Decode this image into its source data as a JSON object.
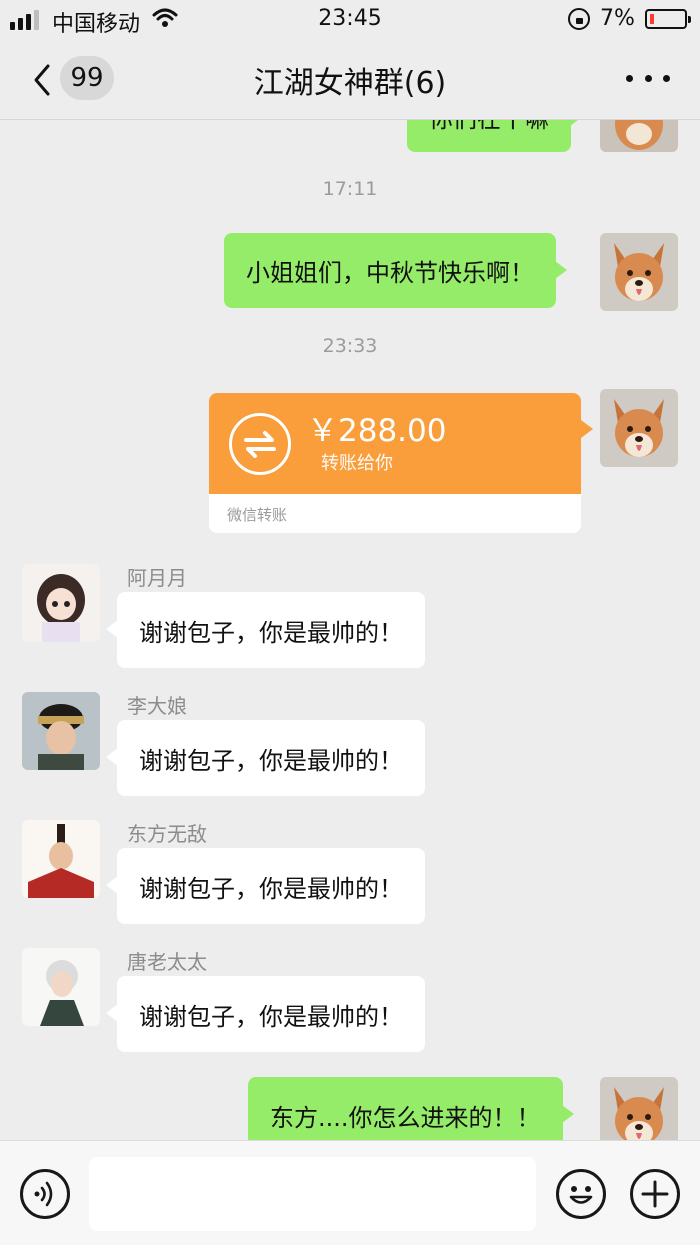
{
  "status_bar": {
    "carrier": "中国移动",
    "time": "23:45",
    "battery_percent": "7%",
    "icons": [
      "signal-icon",
      "wifi-icon",
      "rotation-lock-icon",
      "battery-icon"
    ]
  },
  "nav": {
    "unread_count": "99",
    "title": "江湖女神群(6)",
    "icons": [
      "back-chevron-icon",
      "more-dots-icon"
    ]
  },
  "messages": {
    "top_partial_text": "你们在干嘛",
    "timestamp_1": "17:11",
    "outgoing_1": "小姐姐们，中秋节快乐啊！",
    "timestamp_2": "23:33",
    "transfer": {
      "amount": "￥288.00",
      "description": "转账给你",
      "footer": "微信转账",
      "accent_color": "#fa9d3b"
    },
    "incoming": [
      {
        "sender": "阿月月",
        "text": "谢谢包子，你是最帅的！"
      },
      {
        "sender": "李大娘",
        "text": "谢谢包子，你是最帅的！"
      },
      {
        "sender": "东方无敌",
        "text": "谢谢包子，你是最帅的！"
      },
      {
        "sender": "唐老太太",
        "text": "谢谢包子，你是最帅的！"
      }
    ],
    "outgoing_2": "东方....你怎么进来的！！"
  },
  "input_bar": {
    "placeholder": "",
    "icons": [
      "voice-icon",
      "emoji-icon",
      "plus-icon"
    ]
  },
  "colors": {
    "outgoing_bubble": "#95ec69",
    "incoming_bubble": "#ffffff",
    "background": "#ededed"
  }
}
